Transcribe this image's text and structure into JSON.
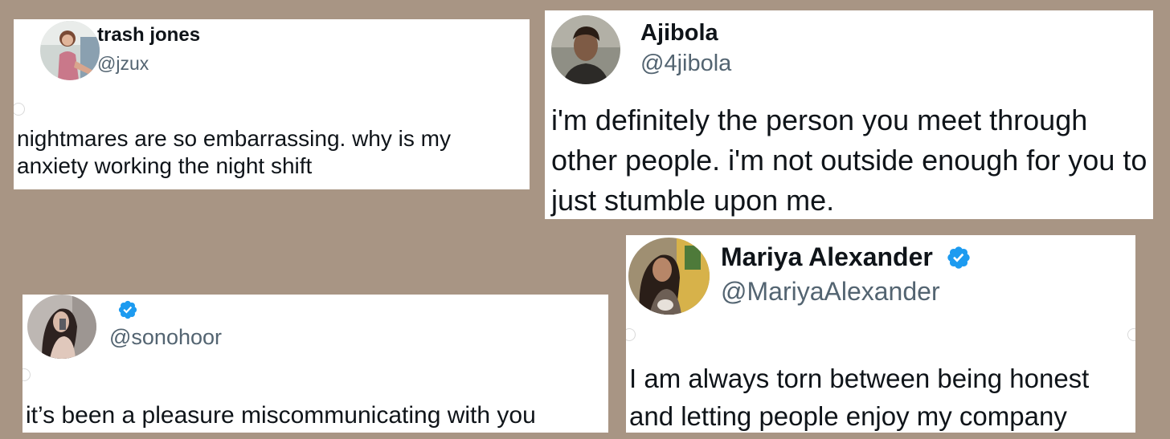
{
  "tweets": [
    {
      "name": "trash jones",
      "handle": "@jzux",
      "verified": false,
      "text": "nightmares are so embarrassing. why is my anxiety working the night shift",
      "avatar_icon": "profile-photo"
    },
    {
      "name": "Ajibola",
      "handle": "@4jibola",
      "verified": false,
      "text": "i'm definitely the person you meet through other people. i'm not outside enough for you to just stumble upon me.",
      "avatar_icon": "profile-photo"
    },
    {
      "name": "",
      "handle": "@sonohoor",
      "verified": true,
      "text": "it’s been a pleasure miscommunicating with you",
      "avatar_icon": "profile-photo"
    },
    {
      "name": "Mariya Alexander",
      "handle": "@MariyaAlexander",
      "verified": true,
      "text": "I am always torn between being honest and letting people enjoy my company",
      "avatar_icon": "profile-photo"
    }
  ],
  "colors": {
    "background": "#a89584",
    "card": "#ffffff",
    "text": "#0f1419",
    "handle": "#536471",
    "verified_badge": "#1d9bf0"
  },
  "icons": {
    "verified": "verified-badge-icon"
  }
}
